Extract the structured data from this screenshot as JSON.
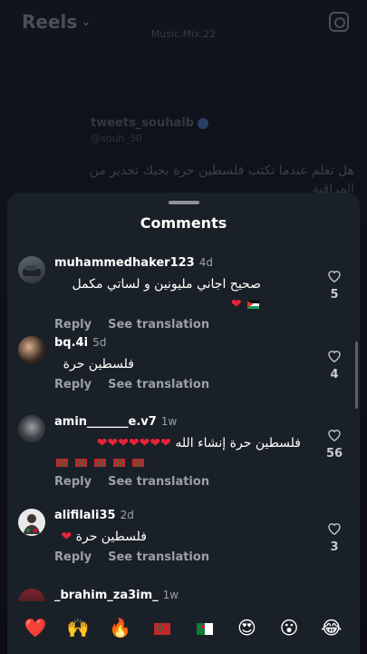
{
  "top_bar": {
    "title": "Reels",
    "chevron": "chevron-down-icon",
    "camera": "camera-icon"
  },
  "reel": {
    "watermark": "Music.Mix.22",
    "author_name": "tweets_souhaib",
    "author_handle": "@souh_30",
    "text_line1": "هل تعلم عندما تكتب فلسطين حرة بجيك تحذير من",
    "text_line2": "المراقبة"
  },
  "sheet": {
    "title": "Comments"
  },
  "comments": [
    {
      "username": "muhammedhaker123",
      "time": "4d",
      "text": "صحيح اجاني مليونين و لساتي مكمل",
      "reply": "Reply",
      "translate": "See translation",
      "likes": "5"
    },
    {
      "username": "bq.4i",
      "time": "5d",
      "text": "فلسطين حرة",
      "reply": "Reply",
      "translate": "See translation",
      "likes": "4"
    },
    {
      "username": "amin_______e.v7",
      "time": "1w",
      "text": "فلسطين حرة إنشاء الله",
      "reply": "Reply",
      "translate": "See translation",
      "likes": "56"
    },
    {
      "username": "alifilali35",
      "time": "2d",
      "text": "فلسطين حرة",
      "reply": "Reply",
      "translate": "See translation",
      "likes": "3"
    },
    {
      "username": "_brahim_za3im_",
      "time": "1w"
    }
  ],
  "emoji_bar": [
    "❤️",
    "🙌",
    "🔥",
    "flag-morocco",
    "flag-algeria",
    "😍",
    "😮",
    "😂"
  ],
  "colors": {
    "sheet_bg": "#1a2027",
    "heart": "#e8223a",
    "muted": "#9aa0a6"
  }
}
